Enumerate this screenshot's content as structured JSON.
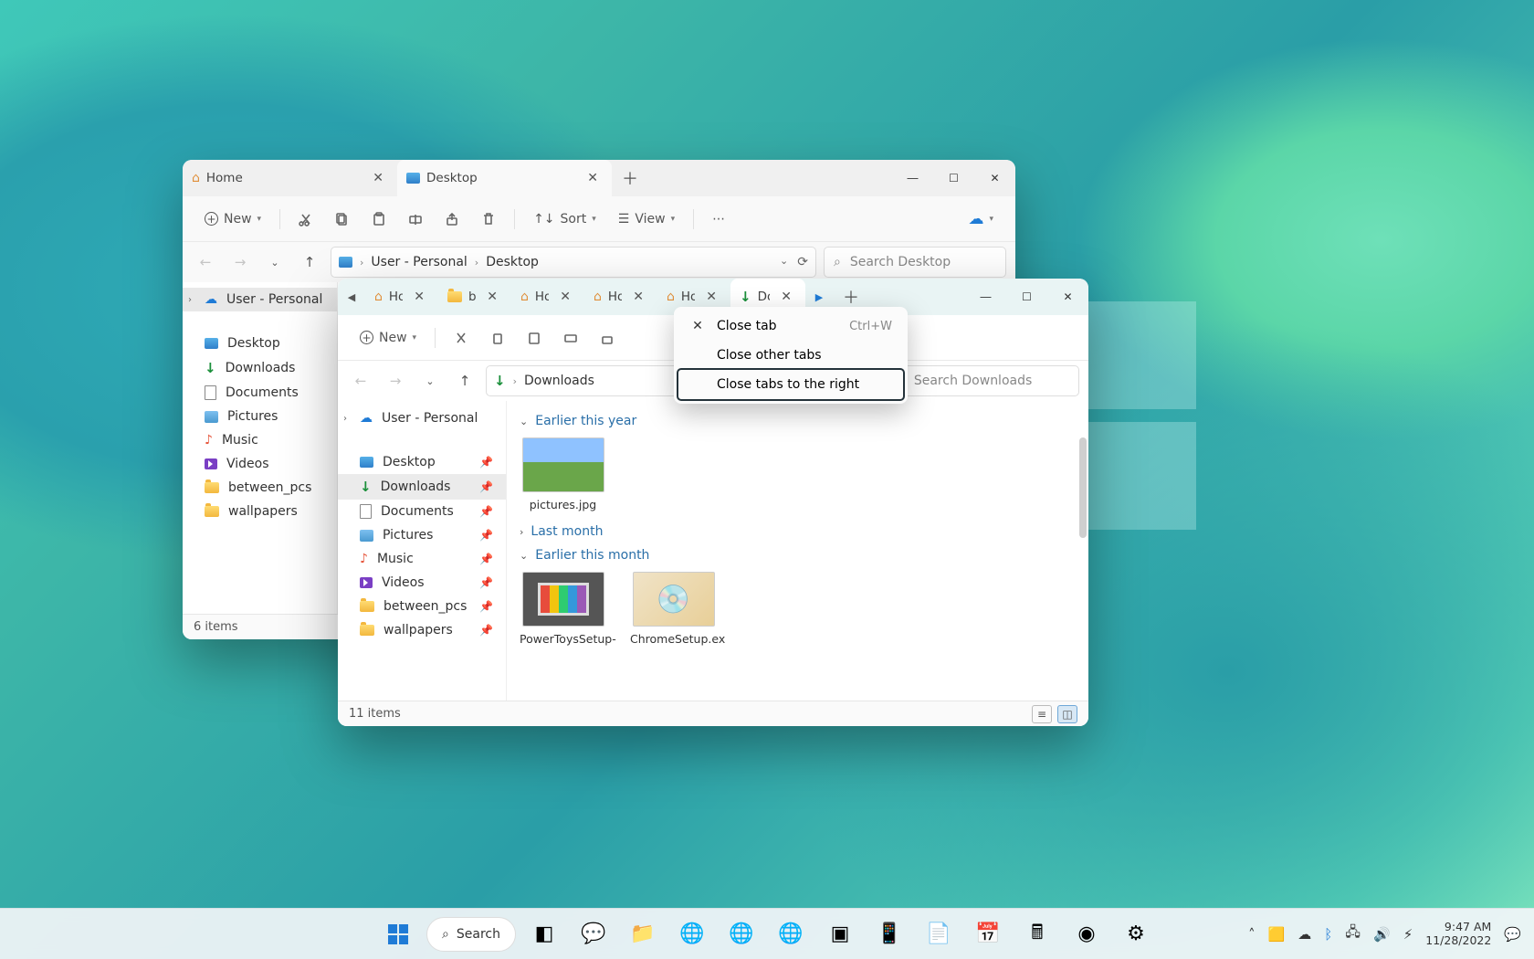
{
  "window1": {
    "tabs": [
      {
        "label": "Home"
      },
      {
        "label": "Desktop"
      }
    ],
    "toolbar": {
      "new_label": "New",
      "sort_label": "Sort",
      "view_label": "View"
    },
    "breadcrumb": {
      "root": "User - Personal",
      "sub": "Desktop"
    },
    "search_placeholder": "Search Desktop",
    "sidebar": {
      "personal": "User - Personal",
      "items": [
        "Desktop",
        "Downloads",
        "Documents",
        "Pictures",
        "Music",
        "Videos",
        "between_pcs",
        "wallpapers"
      ]
    },
    "status": "6 items"
  },
  "window2": {
    "tabs": [
      {
        "label": "Hom"
      },
      {
        "label": "betw"
      },
      {
        "label": "Hom"
      },
      {
        "label": "Hom"
      },
      {
        "label": "Hom"
      },
      {
        "label": "Dow"
      }
    ],
    "toolbar": {
      "new_label": "New"
    },
    "breadcrumb": {
      "root": "Downloads"
    },
    "search_placeholder": "Search Downloads",
    "sidebar": {
      "personal": "User - Personal",
      "items": [
        "Desktop",
        "Downloads",
        "Documents",
        "Pictures",
        "Music",
        "Videos",
        "between_pcs",
        "wallpapers"
      ]
    },
    "groups": {
      "earlier_year": "Earlier this year",
      "last_month": "Last month",
      "earlier_month": "Earlier this month"
    },
    "files": {
      "pictures": "pictures.jpg",
      "powertoys": "PowerToysSetup-",
      "chrome": "ChromeSetup.ex"
    },
    "status": "11 items"
  },
  "context_menu": {
    "close_tab": "Close tab",
    "close_tab_shortcut": "Ctrl+W",
    "close_other": "Close other tabs",
    "close_right": "Close tabs to the right"
  },
  "taskbar": {
    "search": "Search",
    "time": "9:47 AM",
    "date": "11/28/2022"
  }
}
